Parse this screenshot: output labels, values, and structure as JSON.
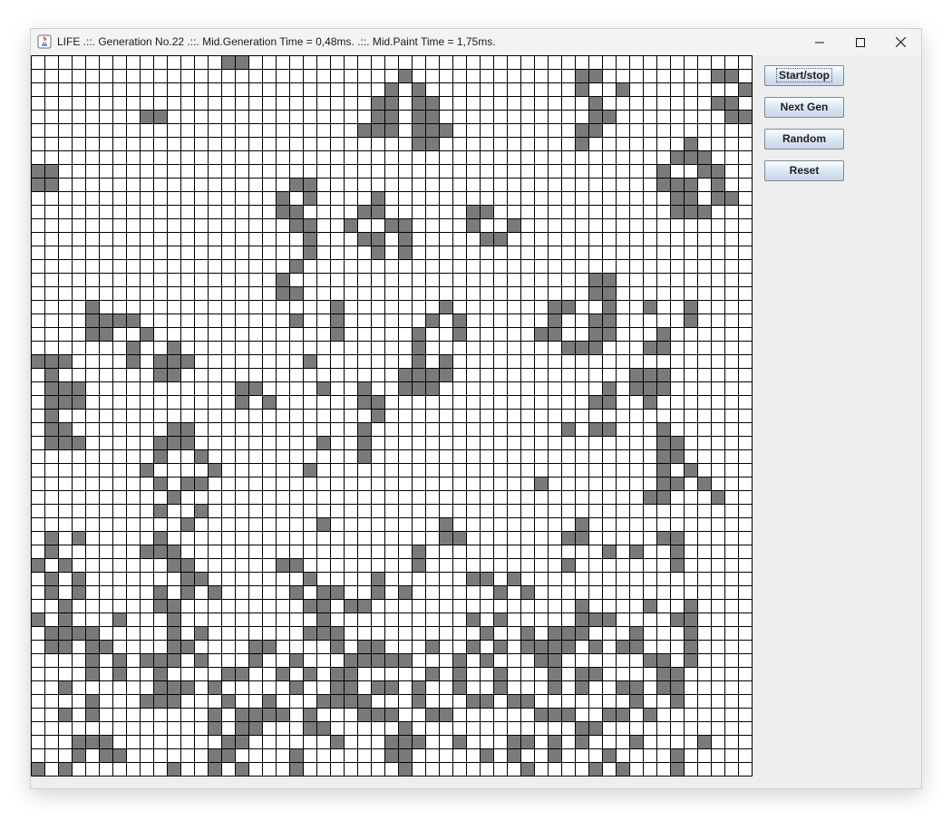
{
  "window": {
    "title": "LIFE .::. Generation No.22 .::. Mid.Generation Time = 0,48ms. .::. Mid.Paint Time = 1,75ms.",
    "icon": "java-icon",
    "controls": [
      "minimize-icon",
      "maximize-icon",
      "close-icon"
    ]
  },
  "buttons": {
    "start_stop": "Start/stop",
    "next_gen": "Next Gen",
    "random": "Random",
    "reset": "Reset"
  },
  "grid": {
    "columns": 53,
    "rows": 53,
    "alive_color": "#7a7a7a",
    "dead_color": "#ffffff",
    "line_color": "#000000",
    "alive": [
      [
        0,
        14
      ],
      [
        0,
        15
      ],
      [
        1,
        27
      ],
      [
        1,
        40
      ],
      [
        1,
        41
      ],
      [
        1,
        50
      ],
      [
        1,
        51
      ],
      [
        2,
        26
      ],
      [
        2,
        28
      ],
      [
        2,
        40
      ],
      [
        2,
        43
      ],
      [
        2,
        52
      ],
      [
        3,
        25
      ],
      [
        3,
        26
      ],
      [
        3,
        28
      ],
      [
        3,
        29
      ],
      [
        3,
        41
      ],
      [
        3,
        50
      ],
      [
        3,
        51
      ],
      [
        4,
        8
      ],
      [
        4,
        9
      ],
      [
        4,
        25
      ],
      [
        4,
        26
      ],
      [
        4,
        28
      ],
      [
        4,
        29
      ],
      [
        4,
        41
      ],
      [
        4,
        42
      ],
      [
        4,
        51
      ],
      [
        4,
        52
      ],
      [
        5,
        24
      ],
      [
        5,
        25
      ],
      [
        5,
        26
      ],
      [
        5,
        28
      ],
      [
        5,
        29
      ],
      [
        5,
        30
      ],
      [
        5,
        40
      ],
      [
        5,
        41
      ],
      [
        6,
        28
      ],
      [
        6,
        29
      ],
      [
        6,
        40
      ],
      [
        6,
        48
      ],
      [
        7,
        47
      ],
      [
        7,
        48
      ],
      [
        7,
        49
      ],
      [
        8,
        0
      ],
      [
        8,
        1
      ],
      [
        8,
        46
      ],
      [
        8,
        49
      ],
      [
        8,
        50
      ],
      [
        9,
        0
      ],
      [
        9,
        1
      ],
      [
        9,
        19
      ],
      [
        9,
        20
      ],
      [
        9,
        46
      ],
      [
        9,
        47
      ],
      [
        9,
        48
      ],
      [
        9,
        50
      ],
      [
        10,
        18
      ],
      [
        10,
        20
      ],
      [
        10,
        25
      ],
      [
        10,
        47
      ],
      [
        10,
        48
      ],
      [
        10,
        50
      ],
      [
        10,
        51
      ],
      [
        11,
        18
      ],
      [
        11,
        19
      ],
      [
        11,
        24
      ],
      [
        11,
        25
      ],
      [
        11,
        32
      ],
      [
        11,
        33
      ],
      [
        11,
        47
      ],
      [
        11,
        48
      ],
      [
        11,
        49
      ],
      [
        12,
        19
      ],
      [
        12,
        20
      ],
      [
        12,
        23
      ],
      [
        12,
        26
      ],
      [
        12,
        27
      ],
      [
        12,
        32
      ],
      [
        12,
        35
      ],
      [
        13,
        20
      ],
      [
        13,
        24
      ],
      [
        13,
        25
      ],
      [
        13,
        27
      ],
      [
        13,
        33
      ],
      [
        13,
        34
      ],
      [
        14,
        20
      ],
      [
        14,
        25
      ],
      [
        14,
        27
      ],
      [
        15,
        19
      ],
      [
        16,
        18
      ],
      [
        16,
        41
      ],
      [
        16,
        42
      ],
      [
        17,
        18
      ],
      [
        17,
        19
      ],
      [
        17,
        41
      ],
      [
        17,
        42
      ],
      [
        18,
        4
      ],
      [
        18,
        22
      ],
      [
        18,
        30
      ],
      [
        18,
        38
      ],
      [
        18,
        39
      ],
      [
        18,
        42
      ],
      [
        18,
        45
      ],
      [
        18,
        48
      ],
      [
        19,
        4
      ],
      [
        19,
        5
      ],
      [
        19,
        6
      ],
      [
        19,
        7
      ],
      [
        19,
        19
      ],
      [
        19,
        22
      ],
      [
        19,
        29
      ],
      [
        19,
        31
      ],
      [
        19,
        38
      ],
      [
        19,
        41
      ],
      [
        19,
        42
      ],
      [
        19,
        48
      ],
      [
        20,
        4
      ],
      [
        20,
        5
      ],
      [
        20,
        8
      ],
      [
        20,
        22
      ],
      [
        20,
        28
      ],
      [
        20,
        31
      ],
      [
        20,
        37
      ],
      [
        20,
        38
      ],
      [
        20,
        41
      ],
      [
        20,
        42
      ],
      [
        20,
        46
      ],
      [
        21,
        7
      ],
      [
        21,
        10
      ],
      [
        21,
        28
      ],
      [
        21,
        39
      ],
      [
        21,
        40
      ],
      [
        21,
        41
      ],
      [
        21,
        45
      ],
      [
        21,
        46
      ],
      [
        22,
        0
      ],
      [
        22,
        1
      ],
      [
        22,
        2
      ],
      [
        22,
        7
      ],
      [
        22,
        9
      ],
      [
        22,
        10
      ],
      [
        22,
        11
      ],
      [
        22,
        20
      ],
      [
        22,
        28
      ],
      [
        22,
        30
      ],
      [
        23,
        1
      ],
      [
        23,
        9
      ],
      [
        23,
        10
      ],
      [
        23,
        27
      ],
      [
        23,
        28
      ],
      [
        23,
        29
      ],
      [
        23,
        30
      ],
      [
        23,
        44
      ],
      [
        23,
        45
      ],
      [
        23,
        46
      ],
      [
        24,
        1
      ],
      [
        24,
        2
      ],
      [
        24,
        3
      ],
      [
        24,
        15
      ],
      [
        24,
        16
      ],
      [
        24,
        21
      ],
      [
        24,
        24
      ],
      [
        24,
        27
      ],
      [
        24,
        28
      ],
      [
        24,
        29
      ],
      [
        24,
        42
      ],
      [
        24,
        44
      ],
      [
        24,
        45
      ],
      [
        24,
        46
      ],
      [
        25,
        1
      ],
      [
        25,
        2
      ],
      [
        25,
        3
      ],
      [
        25,
        15
      ],
      [
        25,
        17
      ],
      [
        25,
        24
      ],
      [
        25,
        25
      ],
      [
        25,
        41
      ],
      [
        25,
        42
      ],
      [
        25,
        45
      ],
      [
        26,
        1
      ],
      [
        26,
        25
      ],
      [
        27,
        1
      ],
      [
        27,
        2
      ],
      [
        27,
        10
      ],
      [
        27,
        11
      ],
      [
        27,
        24
      ],
      [
        27,
        39
      ],
      [
        27,
        41
      ],
      [
        27,
        42
      ],
      [
        27,
        46
      ],
      [
        28,
        1
      ],
      [
        28,
        2
      ],
      [
        28,
        3
      ],
      [
        28,
        9
      ],
      [
        28,
        10
      ],
      [
        28,
        11
      ],
      [
        28,
        21
      ],
      [
        28,
        24
      ],
      [
        28,
        46
      ],
      [
        28,
        47
      ],
      [
        29,
        9
      ],
      [
        29,
        12
      ],
      [
        29,
        24
      ],
      [
        29,
        46
      ],
      [
        29,
        47
      ],
      [
        30,
        8
      ],
      [
        30,
        13
      ],
      [
        30,
        20
      ],
      [
        30,
        46
      ],
      [
        30,
        48
      ],
      [
        31,
        9
      ],
      [
        31,
        11
      ],
      [
        31,
        12
      ],
      [
        31,
        37
      ],
      [
        31,
        46
      ],
      [
        31,
        47
      ],
      [
        31,
        49
      ],
      [
        32,
        10
      ],
      [
        32,
        45
      ],
      [
        32,
        46
      ],
      [
        32,
        50
      ],
      [
        33,
        9
      ],
      [
        33,
        12
      ],
      [
        34,
        11
      ],
      [
        34,
        21
      ],
      [
        34,
        30
      ],
      [
        34,
        40
      ],
      [
        35,
        1
      ],
      [
        35,
        3
      ],
      [
        35,
        9
      ],
      [
        35,
        30
      ],
      [
        35,
        31
      ],
      [
        35,
        39
      ],
      [
        35,
        40
      ],
      [
        35,
        46
      ],
      [
        35,
        47
      ],
      [
        36,
        1
      ],
      [
        36,
        8
      ],
      [
        36,
        9
      ],
      [
        36,
        10
      ],
      [
        36,
        28
      ],
      [
        36,
        42
      ],
      [
        36,
        44
      ],
      [
        36,
        47
      ],
      [
        37,
        0
      ],
      [
        37,
        2
      ],
      [
        37,
        10
      ],
      [
        37,
        11
      ],
      [
        37,
        18
      ],
      [
        37,
        19
      ],
      [
        37,
        28
      ],
      [
        37,
        39
      ],
      [
        37,
        47
      ],
      [
        38,
        1
      ],
      [
        38,
        3
      ],
      [
        38,
        11
      ],
      [
        38,
        12
      ],
      [
        38,
        20
      ],
      [
        38,
        25
      ],
      [
        38,
        32
      ],
      [
        38,
        33
      ],
      [
        38,
        35
      ],
      [
        39,
        1
      ],
      [
        39,
        3
      ],
      [
        39,
        9
      ],
      [
        39,
        11
      ],
      [
        39,
        13
      ],
      [
        39,
        19
      ],
      [
        39,
        21
      ],
      [
        39,
        22
      ],
      [
        39,
        25
      ],
      [
        39,
        27
      ],
      [
        39,
        34
      ],
      [
        39,
        36
      ],
      [
        40,
        2
      ],
      [
        40,
        9
      ],
      [
        40,
        10
      ],
      [
        40,
        20
      ],
      [
        40,
        21
      ],
      [
        40,
        23
      ],
      [
        40,
        24
      ],
      [
        40,
        40
      ],
      [
        40,
        45
      ],
      [
        40,
        48
      ],
      [
        41,
        0
      ],
      [
        41,
        2
      ],
      [
        41,
        6
      ],
      [
        41,
        10
      ],
      [
        41,
        21
      ],
      [
        41,
        32
      ],
      [
        41,
        34
      ],
      [
        41,
        40
      ],
      [
        41,
        41
      ],
      [
        41,
        42
      ],
      [
        41,
        47
      ],
      [
        41,
        48
      ],
      [
        42,
        1
      ],
      [
        42,
        2
      ],
      [
        42,
        3
      ],
      [
        42,
        4
      ],
      [
        42,
        10
      ],
      [
        42,
        12
      ],
      [
        42,
        20
      ],
      [
        42,
        21
      ],
      [
        42,
        22
      ],
      [
        42,
        33
      ],
      [
        42,
        36
      ],
      [
        42,
        38
      ],
      [
        42,
        39
      ],
      [
        42,
        40
      ],
      [
        42,
        44
      ],
      [
        42,
        48
      ],
      [
        43,
        1
      ],
      [
        43,
        2
      ],
      [
        43,
        4
      ],
      [
        43,
        5
      ],
      [
        43,
        10
      ],
      [
        43,
        11
      ],
      [
        43,
        16
      ],
      [
        43,
        17
      ],
      [
        43,
        22
      ],
      [
        43,
        24
      ],
      [
        43,
        25
      ],
      [
        43,
        29
      ],
      [
        43,
        32
      ],
      [
        43,
        34
      ],
      [
        43,
        36
      ],
      [
        43,
        37
      ],
      [
        43,
        38
      ],
      [
        43,
        39
      ],
      [
        43,
        41
      ],
      [
        43,
        43
      ],
      [
        43,
        44
      ],
      [
        43,
        48
      ],
      [
        44,
        4
      ],
      [
        44,
        6
      ],
      [
        44,
        8
      ],
      [
        44,
        9
      ],
      [
        44,
        10
      ],
      [
        44,
        12
      ],
      [
        44,
        16
      ],
      [
        44,
        19
      ],
      [
        44,
        23
      ],
      [
        44,
        24
      ],
      [
        44,
        25
      ],
      [
        44,
        26
      ],
      [
        44,
        27
      ],
      [
        44,
        31
      ],
      [
        44,
        33
      ],
      [
        44,
        37
      ],
      [
        44,
        38
      ],
      [
        44,
        45
      ],
      [
        44,
        46
      ],
      [
        44,
        48
      ],
      [
        45,
        4
      ],
      [
        45,
        6
      ],
      [
        45,
        9
      ],
      [
        45,
        14
      ],
      [
        45,
        15
      ],
      [
        45,
        18
      ],
      [
        45,
        20
      ],
      [
        45,
        22
      ],
      [
        45,
        23
      ],
      [
        45,
        29
      ],
      [
        45,
        31
      ],
      [
        45,
        34
      ],
      [
        45,
        38
      ],
      [
        45,
        40
      ],
      [
        45,
        41
      ],
      [
        45,
        46
      ],
      [
        45,
        47
      ],
      [
        46,
        2
      ],
      [
        46,
        9
      ],
      [
        46,
        10
      ],
      [
        46,
        11
      ],
      [
        46,
        13
      ],
      [
        46,
        19
      ],
      [
        46,
        22
      ],
      [
        46,
        23
      ],
      [
        46,
        25
      ],
      [
        46,
        26
      ],
      [
        46,
        28
      ],
      [
        46,
        31
      ],
      [
        46,
        34
      ],
      [
        46,
        38
      ],
      [
        46,
        40
      ],
      [
        46,
        43
      ],
      [
        46,
        44
      ],
      [
        46,
        46
      ],
      [
        46,
        47
      ],
      [
        47,
        4
      ],
      [
        47,
        8
      ],
      [
        47,
        9
      ],
      [
        47,
        10
      ],
      [
        47,
        14
      ],
      [
        47,
        17
      ],
      [
        47,
        21
      ],
      [
        47,
        22
      ],
      [
        47,
        23
      ],
      [
        47,
        24
      ],
      [
        47,
        28
      ],
      [
        47,
        32
      ],
      [
        47,
        33
      ],
      [
        47,
        35
      ],
      [
        47,
        36
      ],
      [
        47,
        44
      ],
      [
        47,
        47
      ],
      [
        48,
        2
      ],
      [
        48,
        4
      ],
      [
        48,
        13
      ],
      [
        48,
        15
      ],
      [
        48,
        16
      ],
      [
        48,
        17
      ],
      [
        48,
        18
      ],
      [
        48,
        20
      ],
      [
        48,
        24
      ],
      [
        48,
        25
      ],
      [
        48,
        26
      ],
      [
        48,
        29
      ],
      [
        48,
        30
      ],
      [
        48,
        37
      ],
      [
        48,
        38
      ],
      [
        48,
        39
      ],
      [
        48,
        42
      ],
      [
        48,
        43
      ],
      [
        48,
        45
      ],
      [
        49,
        13
      ],
      [
        49,
        15
      ],
      [
        49,
        16
      ],
      [
        49,
        20
      ],
      [
        49,
        21
      ],
      [
        49,
        27
      ],
      [
        49,
        40
      ],
      [
        49,
        41
      ],
      [
        50,
        3
      ],
      [
        50,
        4
      ],
      [
        50,
        5
      ],
      [
        50,
        14
      ],
      [
        50,
        15
      ],
      [
        50,
        22
      ],
      [
        50,
        26
      ],
      [
        50,
        27
      ],
      [
        50,
        28
      ],
      [
        50,
        31
      ],
      [
        50,
        35
      ],
      [
        50,
        36
      ],
      [
        50,
        38
      ],
      [
        50,
        40
      ],
      [
        50,
        44
      ],
      [
        50,
        49
      ],
      [
        51,
        3
      ],
      [
        51,
        5
      ],
      [
        51,
        6
      ],
      [
        51,
        13
      ],
      [
        51,
        14
      ],
      [
        51,
        19
      ],
      [
        51,
        26
      ],
      [
        51,
        27
      ],
      [
        51,
        33
      ],
      [
        51,
        35
      ],
      [
        51,
        38
      ],
      [
        51,
        42
      ],
      [
        51,
        47
      ],
      [
        52,
        0
      ],
      [
        52,
        2
      ],
      [
        52,
        10
      ],
      [
        52,
        13
      ],
      [
        52,
        15
      ],
      [
        52,
        19
      ],
      [
        52,
        27
      ],
      [
        52,
        36
      ],
      [
        52,
        41
      ],
      [
        52,
        43
      ],
      [
        52,
        47
      ]
    ]
  }
}
